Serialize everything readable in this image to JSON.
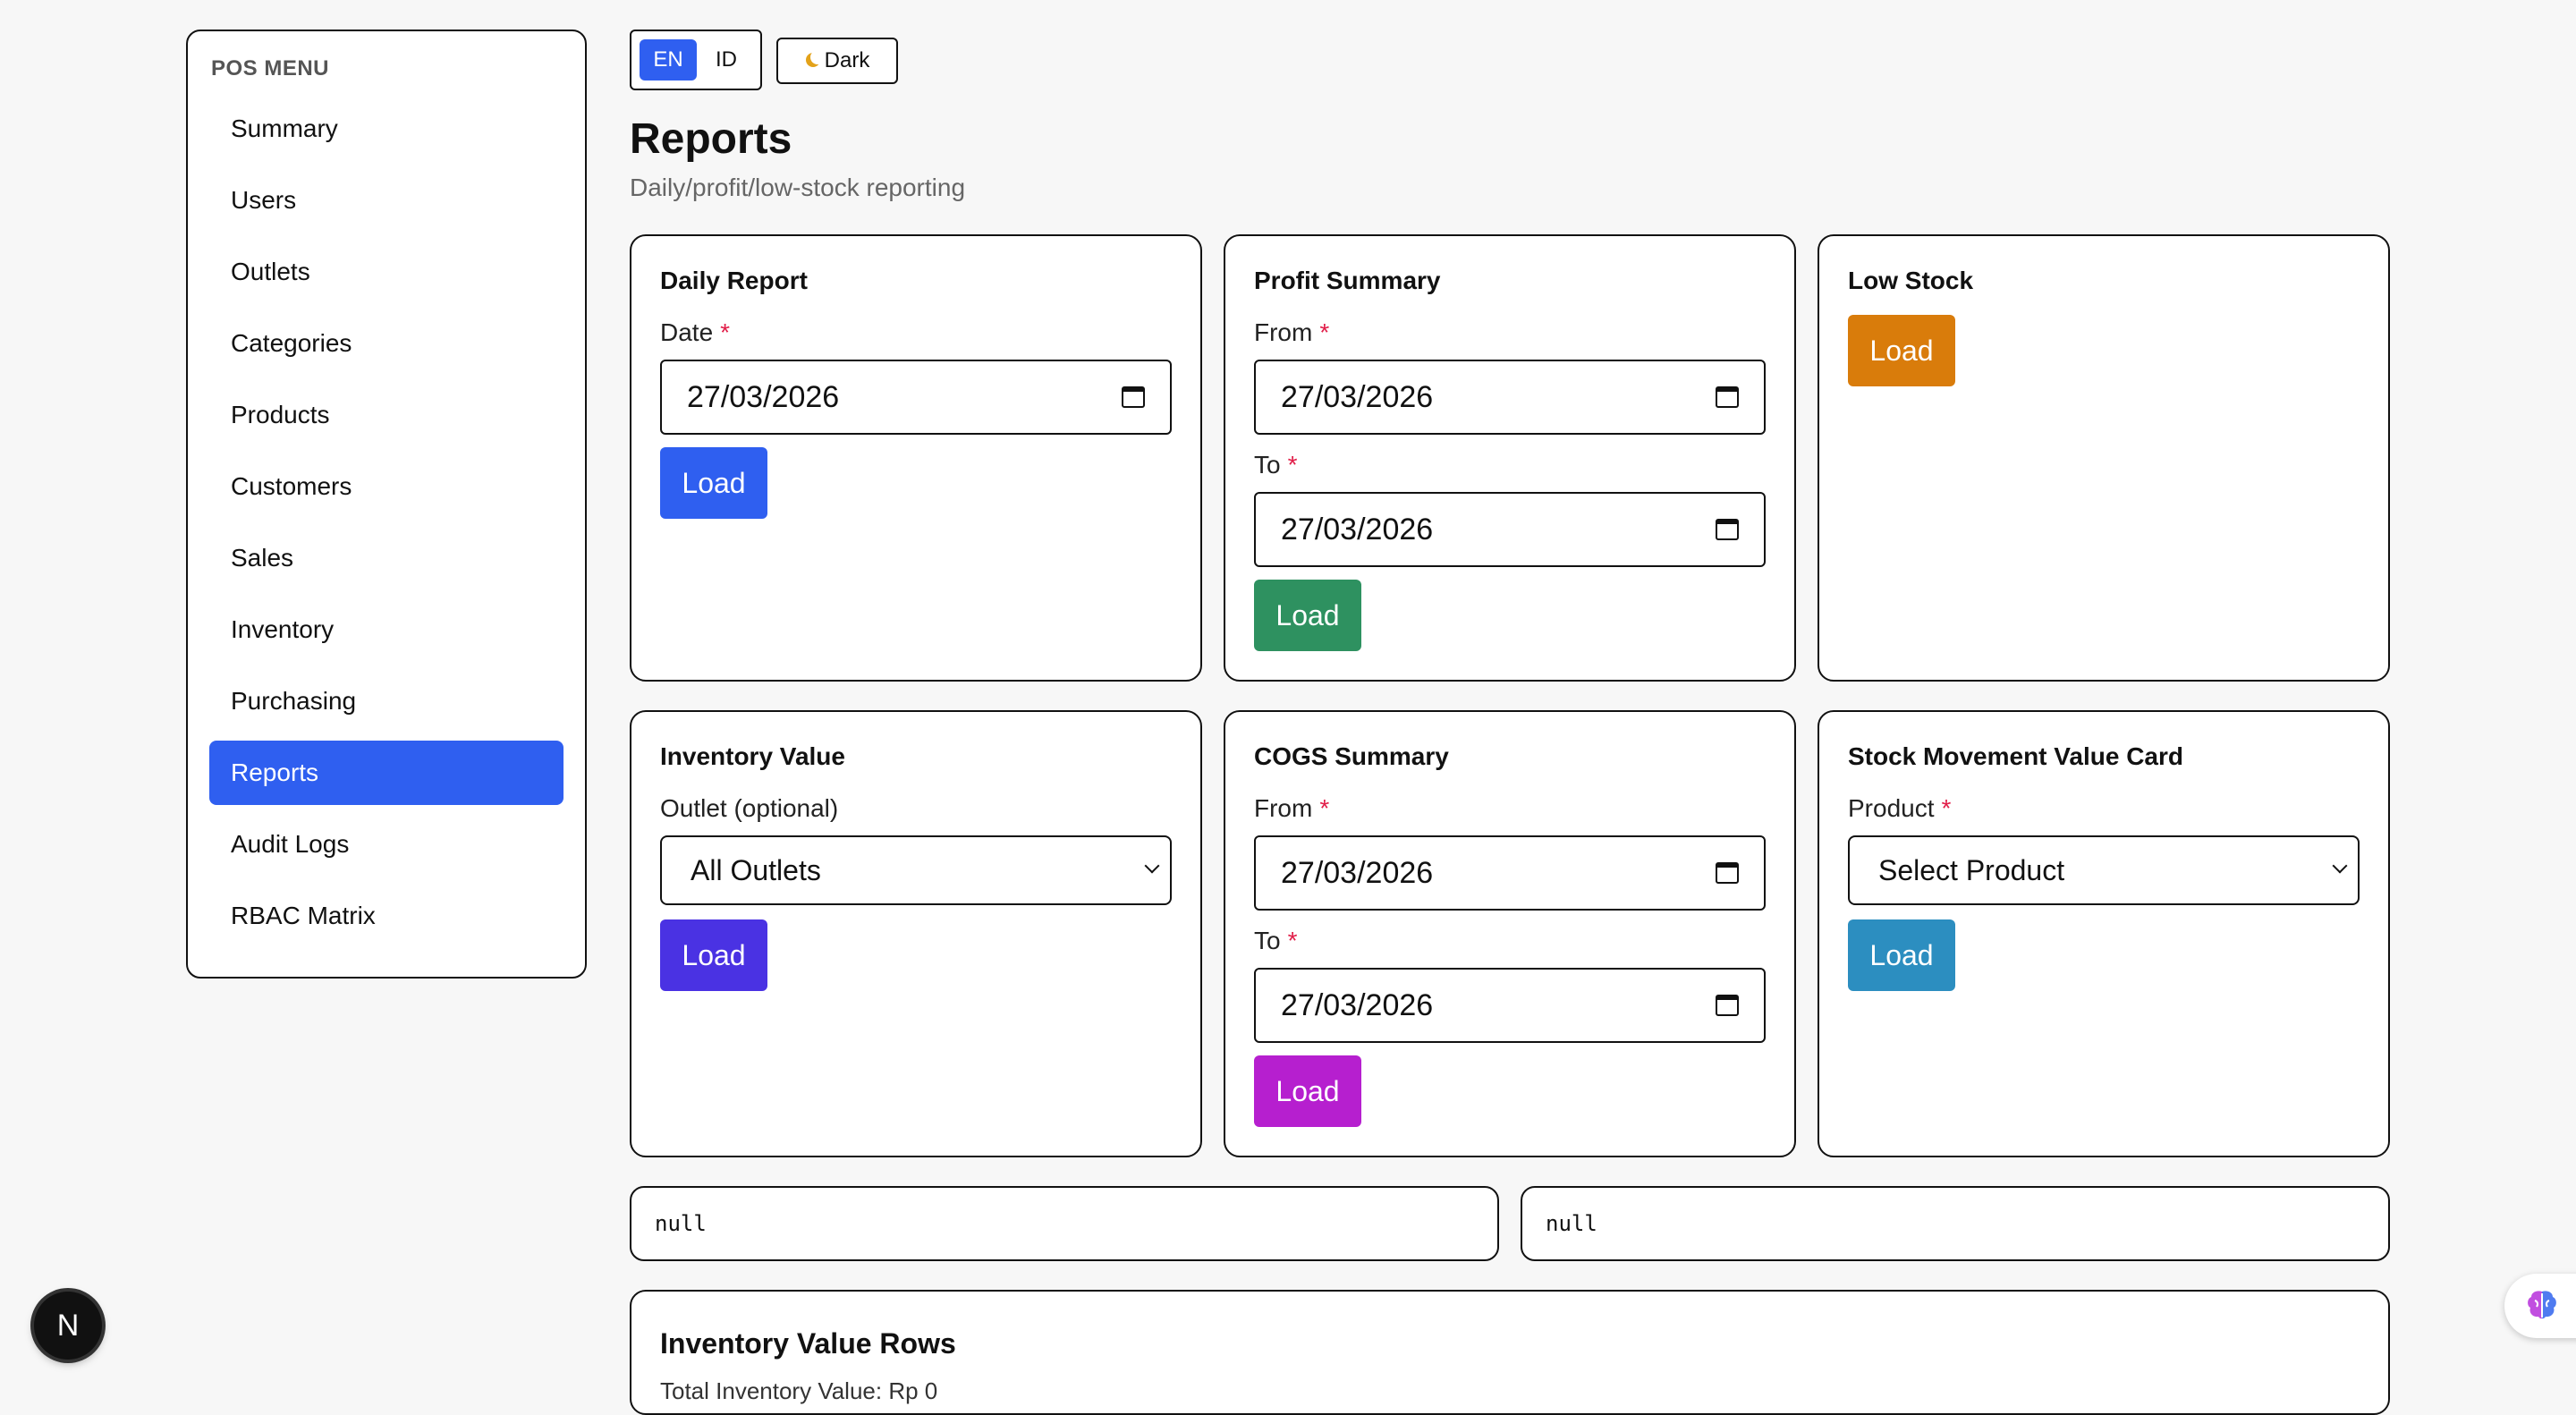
{
  "sidebar": {
    "title": "POS MENU",
    "items": [
      {
        "label": "Summary"
      },
      {
        "label": "Users"
      },
      {
        "label": "Outlets"
      },
      {
        "label": "Categories"
      },
      {
        "label": "Products"
      },
      {
        "label": "Customers"
      },
      {
        "label": "Sales"
      },
      {
        "label": "Inventory"
      },
      {
        "label": "Purchasing"
      },
      {
        "label": "Reports",
        "active": true
      },
      {
        "label": "Audit Logs"
      },
      {
        "label": "RBAC Matrix"
      }
    ]
  },
  "topbar": {
    "lang_en": "EN",
    "lang_id": "ID",
    "theme_label": "Dark"
  },
  "page": {
    "title": "Reports",
    "subtitle": "Daily/profit/low-stock reporting"
  },
  "cards": {
    "daily": {
      "title": "Daily Report",
      "date_label": "Date",
      "date_value": "27/03/2026",
      "load": "Load"
    },
    "profit": {
      "title": "Profit Summary",
      "from_label": "From",
      "from_value": "27/03/2026",
      "to_label": "To",
      "to_value": "27/03/2026",
      "load": "Load"
    },
    "low_stock": {
      "title": "Low Stock",
      "load": "Load"
    },
    "inventory_value": {
      "title": "Inventory Value",
      "outlet_label": "Outlet (optional)",
      "outlet_value": "All Outlets",
      "load": "Load"
    },
    "cogs": {
      "title": "COGS Summary",
      "from_label": "From",
      "from_value": "27/03/2026",
      "to_label": "To",
      "to_value": "27/03/2026",
      "load": "Load"
    },
    "stock_movement": {
      "title": "Stock Movement Value Card",
      "product_label": "Product",
      "product_value": "Select Product",
      "load": "Load"
    }
  },
  "outputs": {
    "left": "null",
    "right": "null"
  },
  "inventory_rows": {
    "title": "Inventory Value Rows",
    "subtitle": "Total Inventory Value: Rp 0"
  },
  "required_mark": "*",
  "badge": {
    "label": "N"
  },
  "colors": {
    "primary": "#2f5ff0",
    "green": "#2e9160",
    "orange": "#d97c0b",
    "indigo": "#4a32e3",
    "magenta": "#b61fcf",
    "teal": "#2c8ec0"
  }
}
